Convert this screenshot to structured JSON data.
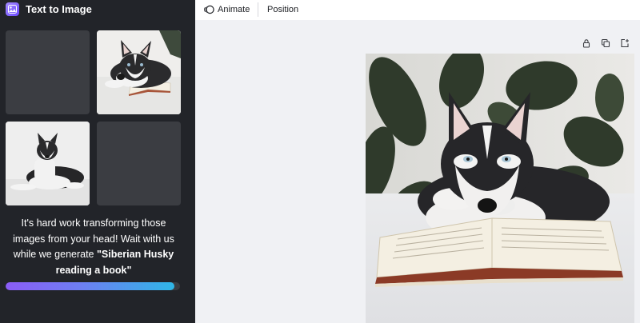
{
  "panel": {
    "title": "Text to Image",
    "app_icon": "text-to-image-app-icon",
    "message_prefix": "It's hard work transforming those images from your head! Wait with us while we generate ",
    "prompt": "\"Siberian Husky reading a book\"",
    "progress": 0.97,
    "progress_colors": [
      "#8b5cf6",
      "#6d7ff2",
      "#2fb6e6"
    ],
    "tiles": [
      {
        "state": "loading"
      },
      {
        "state": "image",
        "subject": "husky lying on open book"
      },
      {
        "state": "image",
        "subject": "husky lying on floor"
      },
      {
        "state": "loading"
      }
    ]
  },
  "toolbar": {
    "animate_label": "Animate",
    "position_label": "Position"
  },
  "canvas": {
    "tools": [
      "lock-icon",
      "duplicate-icon",
      "add-page-icon"
    ],
    "image_subject": "Siberian Husky reading a book"
  },
  "colors": {
    "panel_bg": "#222429",
    "canvas_bg": "#f0f1f4",
    "toolbar_bg": "#ffffff",
    "placeholder": "#3b3d42"
  }
}
